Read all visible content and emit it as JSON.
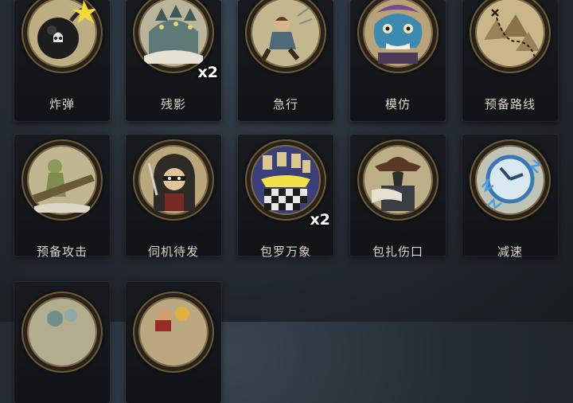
{
  "cards": [
    {
      "label": "炸弹",
      "icon": "bomb-icon",
      "count": ""
    },
    {
      "label": "残影",
      "icon": "afterimage-icon",
      "count": "x2"
    },
    {
      "label": "急行",
      "icon": "dash-icon",
      "count": ""
    },
    {
      "label": "模仿",
      "icon": "mimic-mask-icon",
      "count": ""
    },
    {
      "label": "预备路线",
      "icon": "route-map-icon",
      "count": ""
    },
    {
      "label": "预备攻击",
      "icon": "ready-attack-icon",
      "count": ""
    },
    {
      "label": "伺机待发",
      "icon": "lurk-icon",
      "count": ""
    },
    {
      "label": "包罗万象",
      "icon": "all-inclusive-icon",
      "count": "x2"
    },
    {
      "label": "包扎伤口",
      "icon": "bandage-icon",
      "count": ""
    },
    {
      "label": "减速",
      "icon": "slow-clock-icon",
      "count": ""
    },
    {
      "label": "",
      "icon": "card-art-icon",
      "count": ""
    },
    {
      "label": "",
      "icon": "card-art-icon",
      "count": ""
    }
  ],
  "colors": {
    "parchment": "#c7b98f",
    "rim": "#7b6a48",
    "label": "#d9d4c8"
  }
}
